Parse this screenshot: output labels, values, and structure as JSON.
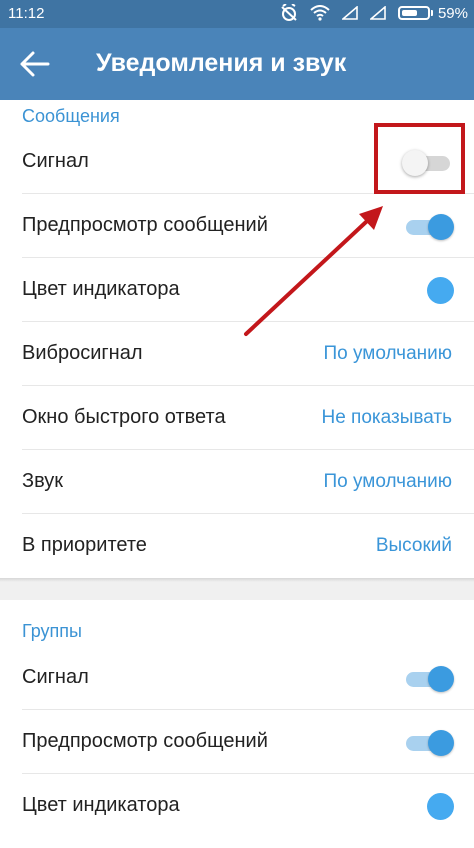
{
  "status_bar": {
    "time": "11:12",
    "battery": "59%"
  },
  "app_bar": {
    "title": "Уведомления и звук"
  },
  "sections": [
    {
      "header": "Сообщения",
      "rows": [
        {
          "label": "Сигнал",
          "control": "switch",
          "on": false
        },
        {
          "label": "Предпросмотр сообщений",
          "control": "switch",
          "on": true
        },
        {
          "label": "Цвет индикатора",
          "control": "color",
          "color": "#45aaf0"
        },
        {
          "label": "Вибросигнал",
          "value": "По умолчанию"
        },
        {
          "label": "Окно быстрого ответа",
          "value": "Не показывать"
        },
        {
          "label": "Звук",
          "value": "По умолчанию"
        },
        {
          "label": "В приоритете",
          "value": "Высокий"
        }
      ]
    },
    {
      "header": "Группы",
      "rows": [
        {
          "label": "Сигнал",
          "control": "switch",
          "on": true
        },
        {
          "label": "Предпросмотр сообщений",
          "control": "switch",
          "on": true
        },
        {
          "label": "Цвет индикатора",
          "control": "color",
          "color": "#45aaf0"
        }
      ]
    }
  ],
  "colors": {
    "status_bar": "#3f74a3",
    "app_bar": "#4a84b9",
    "accent": "#3b93d4",
    "annotation": "#c3171b"
  },
  "annotation": {
    "type": "red-box-with-arrow",
    "target": "sections.0.rows.0"
  }
}
